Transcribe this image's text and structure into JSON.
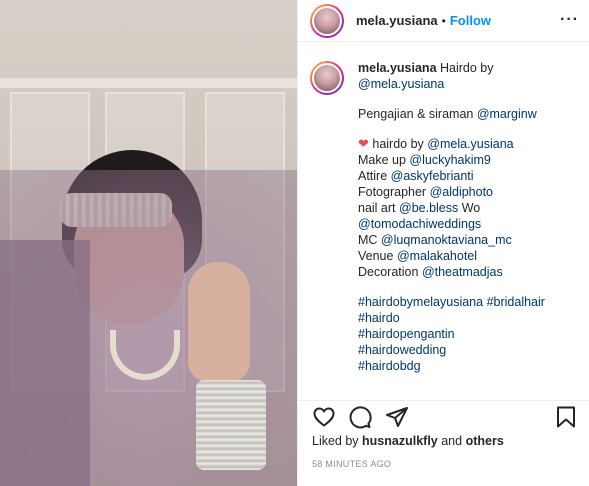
{
  "post": {
    "username": "mela.yusiana",
    "follow_label": "Follow",
    "dot": "•",
    "more_label": "···"
  },
  "caption": {
    "username": "mela.yusiana",
    "intro": " Hairdo by",
    "intro_mention": "@mela.yusiana",
    "line_pengajian_text": "Pengajian & siraman ",
    "line_pengajian_mention": "@marginw",
    "hairdo_text": " hairdo by ",
    "hairdo_mention": "@mela.yusiana",
    "makeup_text": "Make up ",
    "makeup_mention": "@luckyhakim9",
    "attire_text": "Attire ",
    "attire_mention": "@askyfebrianti",
    "fotographer_text": "Fotographer ",
    "fotographer_mention": "@aldiphoto",
    "nailart_text": "nail art ",
    "nailart_mention": "@be.bless",
    "nailart_suffix": " Wo",
    "wo_mention": "@tomodachiweddings",
    "mc_text": "MC ",
    "mc_mention": "@luqmanoktaviana_mc",
    "venue_text": "Venue ",
    "venue_mention": "@malakahotel",
    "decoration_text": "Decoration ",
    "decoration_mention": "@theatmadjas",
    "hashtag1": "#hairdobymelayusiana",
    "hashtag2": "#bridalhair",
    "hashtag3": "#hairdo",
    "hashtag4": "#hairdopengantin",
    "hashtag5": "#hairdowedding",
    "hashtag6": "#hairdobdg"
  },
  "likes": {
    "prefix": "Liked by ",
    "user": "husnazulkfly",
    "middle": " and ",
    "others": "others"
  },
  "timestamp": "58 MINUTES AGO",
  "icons": {
    "like": "heart-outline-icon",
    "comment": "comment-icon",
    "share": "paper-plane-icon",
    "save": "bookmark-icon",
    "caption_heart": "red-heart-emoji"
  },
  "colors": {
    "link": "#00376b",
    "follow": "#0095f6",
    "heart": "#ed4956",
    "muted": "#8e8e8e"
  }
}
